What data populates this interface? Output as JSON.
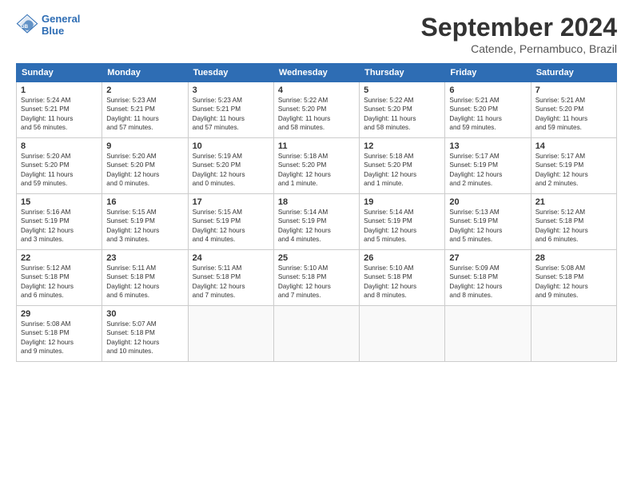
{
  "header": {
    "logo_line1": "General",
    "logo_line2": "Blue",
    "month": "September 2024",
    "location": "Catende, Pernambuco, Brazil"
  },
  "days_of_week": [
    "Sunday",
    "Monday",
    "Tuesday",
    "Wednesday",
    "Thursday",
    "Friday",
    "Saturday"
  ],
  "weeks": [
    [
      {
        "day": "1",
        "info": "Sunrise: 5:24 AM\nSunset: 5:21 PM\nDaylight: 11 hours\nand 56 minutes."
      },
      {
        "day": "2",
        "info": "Sunrise: 5:23 AM\nSunset: 5:21 PM\nDaylight: 11 hours\nand 57 minutes."
      },
      {
        "day": "3",
        "info": "Sunrise: 5:23 AM\nSunset: 5:21 PM\nDaylight: 11 hours\nand 57 minutes."
      },
      {
        "day": "4",
        "info": "Sunrise: 5:22 AM\nSunset: 5:20 PM\nDaylight: 11 hours\nand 58 minutes."
      },
      {
        "day": "5",
        "info": "Sunrise: 5:22 AM\nSunset: 5:20 PM\nDaylight: 11 hours\nand 58 minutes."
      },
      {
        "day": "6",
        "info": "Sunrise: 5:21 AM\nSunset: 5:20 PM\nDaylight: 11 hours\nand 59 minutes."
      },
      {
        "day": "7",
        "info": "Sunrise: 5:21 AM\nSunset: 5:20 PM\nDaylight: 11 hours\nand 59 minutes."
      }
    ],
    [
      {
        "day": "8",
        "info": "Sunrise: 5:20 AM\nSunset: 5:20 PM\nDaylight: 11 hours\nand 59 minutes."
      },
      {
        "day": "9",
        "info": "Sunrise: 5:20 AM\nSunset: 5:20 PM\nDaylight: 12 hours\nand 0 minutes."
      },
      {
        "day": "10",
        "info": "Sunrise: 5:19 AM\nSunset: 5:20 PM\nDaylight: 12 hours\nand 0 minutes."
      },
      {
        "day": "11",
        "info": "Sunrise: 5:18 AM\nSunset: 5:20 PM\nDaylight: 12 hours\nand 1 minute."
      },
      {
        "day": "12",
        "info": "Sunrise: 5:18 AM\nSunset: 5:20 PM\nDaylight: 12 hours\nand 1 minute."
      },
      {
        "day": "13",
        "info": "Sunrise: 5:17 AM\nSunset: 5:19 PM\nDaylight: 12 hours\nand 2 minutes."
      },
      {
        "day": "14",
        "info": "Sunrise: 5:17 AM\nSunset: 5:19 PM\nDaylight: 12 hours\nand 2 minutes."
      }
    ],
    [
      {
        "day": "15",
        "info": "Sunrise: 5:16 AM\nSunset: 5:19 PM\nDaylight: 12 hours\nand 3 minutes."
      },
      {
        "day": "16",
        "info": "Sunrise: 5:15 AM\nSunset: 5:19 PM\nDaylight: 12 hours\nand 3 minutes."
      },
      {
        "day": "17",
        "info": "Sunrise: 5:15 AM\nSunset: 5:19 PM\nDaylight: 12 hours\nand 4 minutes."
      },
      {
        "day": "18",
        "info": "Sunrise: 5:14 AM\nSunset: 5:19 PM\nDaylight: 12 hours\nand 4 minutes."
      },
      {
        "day": "19",
        "info": "Sunrise: 5:14 AM\nSunset: 5:19 PM\nDaylight: 12 hours\nand 5 minutes."
      },
      {
        "day": "20",
        "info": "Sunrise: 5:13 AM\nSunset: 5:19 PM\nDaylight: 12 hours\nand 5 minutes."
      },
      {
        "day": "21",
        "info": "Sunrise: 5:12 AM\nSunset: 5:18 PM\nDaylight: 12 hours\nand 6 minutes."
      }
    ],
    [
      {
        "day": "22",
        "info": "Sunrise: 5:12 AM\nSunset: 5:18 PM\nDaylight: 12 hours\nand 6 minutes."
      },
      {
        "day": "23",
        "info": "Sunrise: 5:11 AM\nSunset: 5:18 PM\nDaylight: 12 hours\nand 6 minutes."
      },
      {
        "day": "24",
        "info": "Sunrise: 5:11 AM\nSunset: 5:18 PM\nDaylight: 12 hours\nand 7 minutes."
      },
      {
        "day": "25",
        "info": "Sunrise: 5:10 AM\nSunset: 5:18 PM\nDaylight: 12 hours\nand 7 minutes."
      },
      {
        "day": "26",
        "info": "Sunrise: 5:10 AM\nSunset: 5:18 PM\nDaylight: 12 hours\nand 8 minutes."
      },
      {
        "day": "27",
        "info": "Sunrise: 5:09 AM\nSunset: 5:18 PM\nDaylight: 12 hours\nand 8 minutes."
      },
      {
        "day": "28",
        "info": "Sunrise: 5:08 AM\nSunset: 5:18 PM\nDaylight: 12 hours\nand 9 minutes."
      }
    ],
    [
      {
        "day": "29",
        "info": "Sunrise: 5:08 AM\nSunset: 5:18 PM\nDaylight: 12 hours\nand 9 minutes."
      },
      {
        "day": "30",
        "info": "Sunrise: 5:07 AM\nSunset: 5:18 PM\nDaylight: 12 hours\nand 10 minutes."
      },
      {
        "day": "",
        "info": ""
      },
      {
        "day": "",
        "info": ""
      },
      {
        "day": "",
        "info": ""
      },
      {
        "day": "",
        "info": ""
      },
      {
        "day": "",
        "info": ""
      }
    ]
  ]
}
